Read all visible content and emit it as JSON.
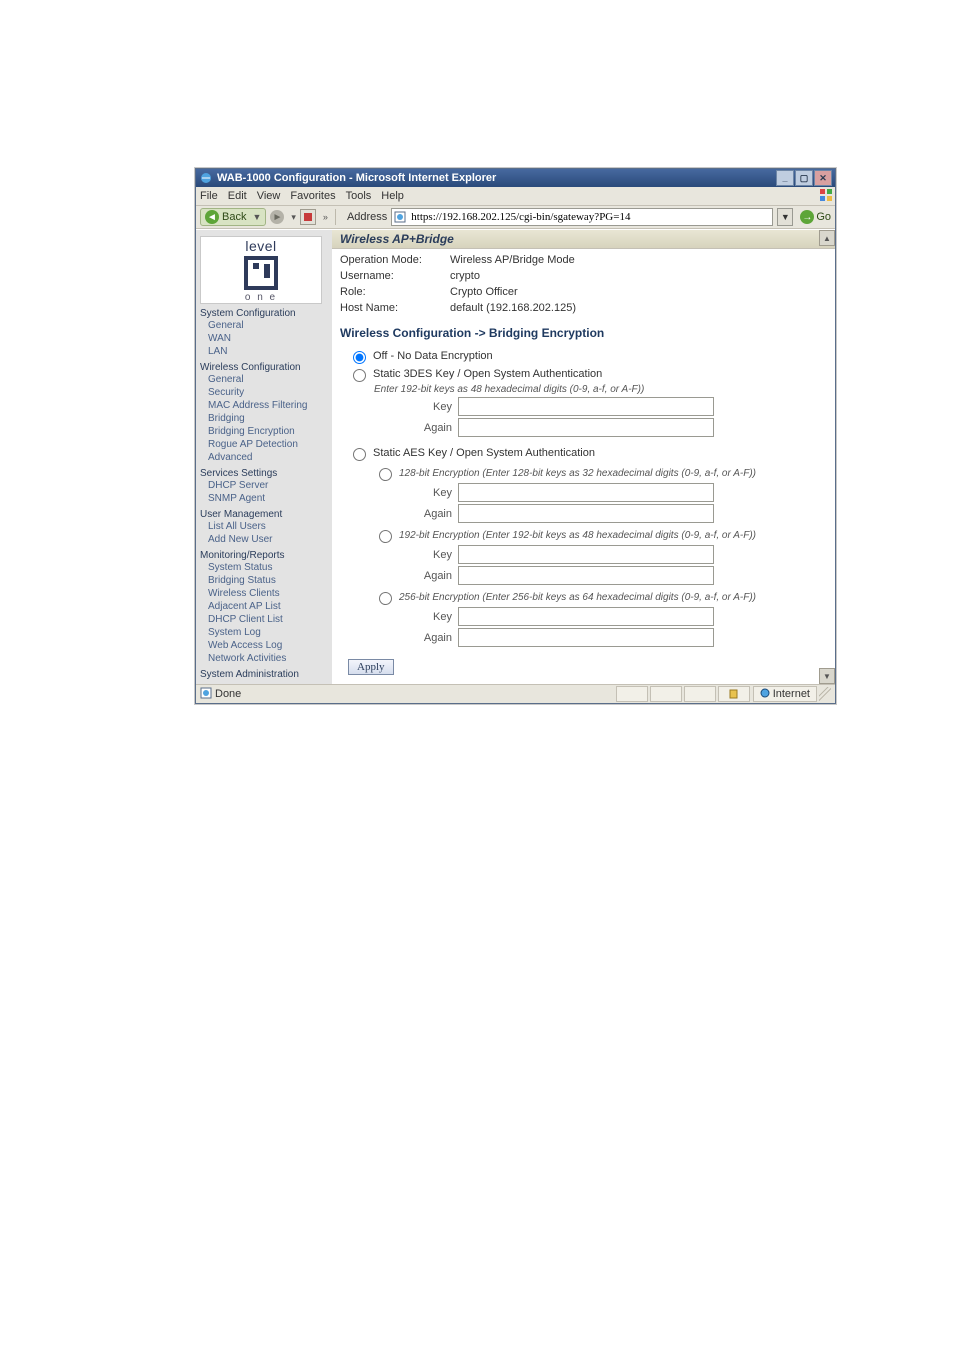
{
  "window": {
    "title": "WAB-1000 Configuration - Microsoft Internet Explorer"
  },
  "menubar": [
    "File",
    "Edit",
    "View",
    "Favorites",
    "Tools",
    "Help"
  ],
  "toolbar": {
    "back_label": "Back",
    "address_label": "Address",
    "address_value": "https://192.168.202.125/cgi-bin/sgateway?PG=14",
    "go_label": "Go"
  },
  "logo": {
    "brand": "level",
    "sub": "o n e"
  },
  "sidebar": {
    "system_config": {
      "header": "System Configuration",
      "items": [
        "General",
        "WAN",
        "LAN"
      ]
    },
    "wireless_config": {
      "header": "Wireless Configuration",
      "items": [
        "General",
        "Security",
        "MAC Address Filtering",
        "Bridging",
        "Bridging Encryption",
        "Rogue AP Detection",
        "Advanced"
      ]
    },
    "services": {
      "header": "Services Settings",
      "items": [
        "DHCP Server",
        "SNMP Agent"
      ]
    },
    "user_mgmt": {
      "header": "User Management",
      "items": [
        "List All Users",
        "Add New User"
      ]
    },
    "monitoring": {
      "header": "Monitoring/Reports",
      "items": [
        "System Status",
        "Bridging Status",
        "Wireless Clients",
        "Adjacent AP List",
        "DHCP Client List",
        "System Log",
        "Web Access Log",
        "Network Activities"
      ]
    },
    "sysadmin": {
      "header": "System Administration"
    }
  },
  "main": {
    "section_title": "Wireless AP+Bridge",
    "kv": {
      "op_mode_k": "Operation Mode:",
      "op_mode_v": "Wireless AP/Bridge Mode",
      "user_k": "Username:",
      "user_v": "crypto",
      "role_k": "Role:",
      "role_v": "Crypto Officer",
      "host_k": "Host Name:",
      "host_v": "default (192.168.202.125)"
    },
    "subtitle": "Wireless Configuration -> Bridging Encryption",
    "opts": {
      "off": "Off - No Data Encryption",
      "tdes": "Static 3DES Key / Open System Authentication",
      "tdes_hint": "Enter 192-bit keys as 48 hexadecimal digits (0-9, a-f, or A-F))",
      "aes": "Static AES Key / Open System Authentication",
      "aes128": "128-bit Encryption (Enter 128-bit keys as 32 hexadecimal digits (0-9, a-f, or A-F))",
      "aes192": "192-bit Encryption (Enter 192-bit keys as 48 hexadecimal digits (0-9, a-f, or A-F))",
      "aes256": "256-bit Encryption (Enter 256-bit keys as 64 hexadecimal digits (0-9, a-f, or A-F))"
    },
    "labels": {
      "key": "Key",
      "again": "Again"
    },
    "apply": "Apply"
  },
  "status": {
    "done": "Done",
    "zone": "Internet"
  }
}
